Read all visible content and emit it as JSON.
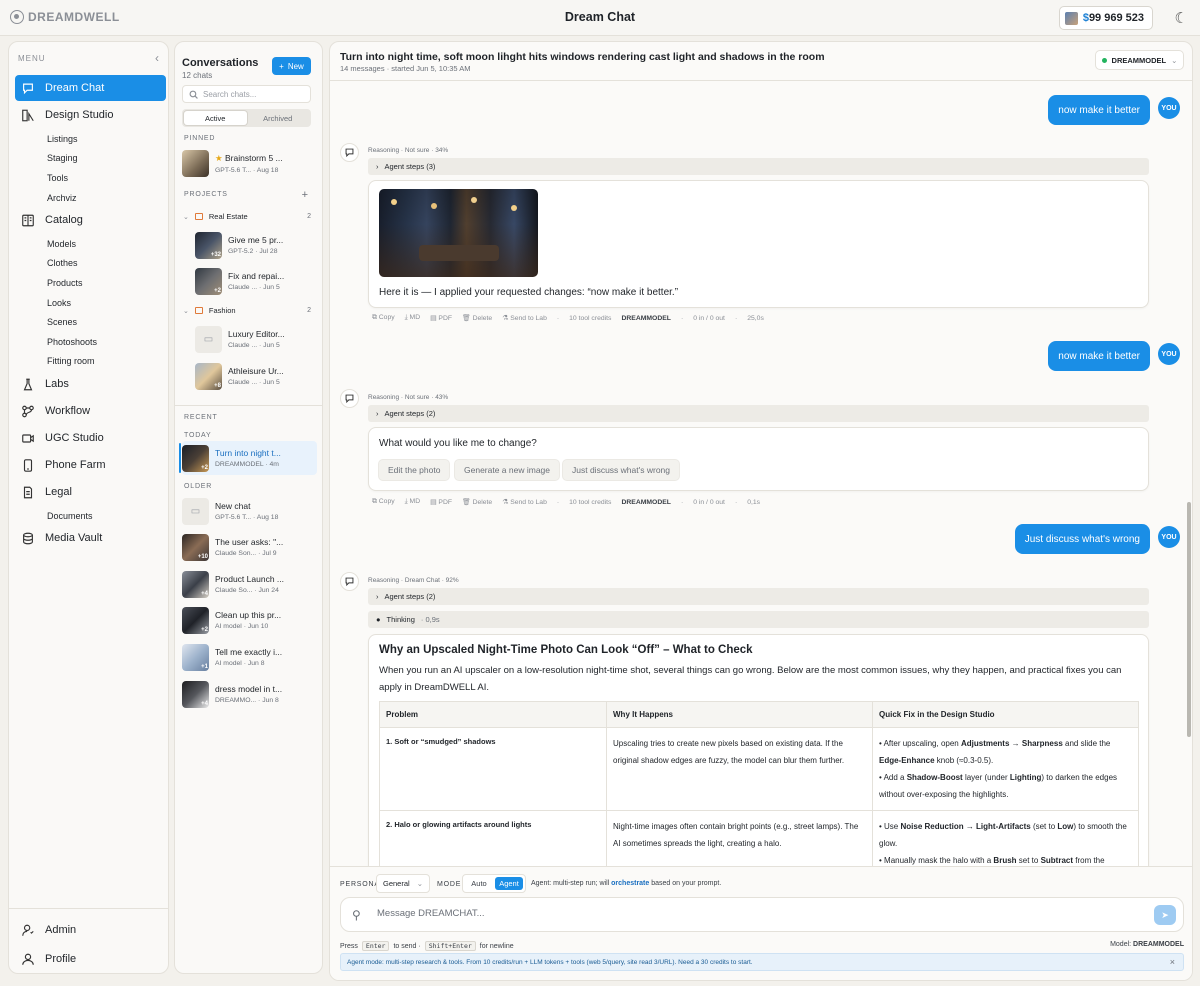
{
  "app": {
    "logo_text": "DREAMDWELL",
    "title": "Dream Chat",
    "credits": "99 969 523",
    "currency": "$"
  },
  "sidebar": {
    "menu_label": "MENU",
    "items": [
      {
        "label": "Dream Chat",
        "icon": "chat-icon",
        "active": true
      },
      {
        "label": "Design Studio",
        "icon": "design-icon"
      },
      {
        "label": "Catalog",
        "icon": "catalog-icon"
      },
      {
        "label": "Labs",
        "icon": "flask-icon"
      },
      {
        "label": "Workflow",
        "icon": "workflow-icon"
      },
      {
        "label": "UGC Studio",
        "icon": "ugc-icon"
      },
      {
        "label": "Phone Farm",
        "icon": "phone-icon"
      },
      {
        "label": "Legal",
        "icon": "document-icon"
      },
      {
        "label": "Media Vault",
        "icon": "database-icon"
      }
    ],
    "design_sub": [
      "Listings",
      "Staging",
      "Tools",
      "Archviz"
    ],
    "catalog_sub": [
      "Models",
      "Clothes",
      "Products",
      "Looks",
      "Scenes",
      "Photoshoots",
      "Fitting room"
    ],
    "legal_sub": [
      "Documents"
    ],
    "bottom": [
      {
        "label": "Admin",
        "icon": "admin-icon"
      },
      {
        "label": "Profile",
        "icon": "profile-icon"
      }
    ]
  },
  "conversations": {
    "title": "Conversations",
    "count": "12 chats",
    "new_label": "New",
    "search_placeholder": "Search chats...",
    "tabs": [
      "Active",
      "Archived"
    ],
    "pinned_label": "PINNED",
    "pinned": [
      {
        "title": "Brainstorm 5 ...",
        "meta": "GPT-5.6 T...  ·  Aug 18"
      }
    ],
    "projects_label": "PROJECTS",
    "folders": [
      {
        "name": "Real Estate",
        "count": "2",
        "items": [
          {
            "title": "Give me 5 pr...",
            "meta": "GPT-5.2  ·  Jul 28",
            "badge": "+32"
          },
          {
            "title": "Fix and repai...",
            "meta": "Claude ...  ·  Jun 5",
            "badge": "+2"
          }
        ]
      },
      {
        "name": "Fashion",
        "count": "2",
        "items": [
          {
            "title": "Luxury Editor...",
            "meta": "Claude ...  ·  Jun 5",
            "badge": ""
          },
          {
            "title": "Athleisure Ur...",
            "meta": "Claude ...  ·  Jun 5",
            "badge": "+8"
          }
        ]
      }
    ],
    "recent_label": "RECENT",
    "today_label": "TODAY",
    "today": [
      {
        "title": "Turn into night t...",
        "meta": "DREAMMODEL  ·  4m",
        "badge": "+2"
      }
    ],
    "older_label": "OLDER",
    "older": [
      {
        "title": "New chat",
        "meta": "GPT-5.6 T...  ·  Aug 18",
        "badge": ""
      },
      {
        "title": "The user asks: \"...",
        "meta": "Claude Son...  ·  Jul 9",
        "badge": "+10"
      },
      {
        "title": "Product Launch ...",
        "meta": "Claude So...  ·  Jun 24",
        "badge": "+4"
      },
      {
        "title": "Clean up this pr...",
        "meta": "AI model  ·  Jun 10",
        "badge": "+2"
      },
      {
        "title": "Tell me exactly i...",
        "meta": "AI model  ·  Jun 8",
        "badge": "+1"
      },
      {
        "title": "dress model in t...",
        "meta": "DREAMMO...  ·  Jun 8",
        "badge": "+4"
      }
    ]
  },
  "chat": {
    "title": "Turn into night time, soft moon lihght hits windows rendering cast light and shadows in the room",
    "subtitle": "14 messages · started Jun 5, 10:35 AM",
    "model": "DREAMMODEL",
    "user_messages": [
      "now make it better",
      "now make it better",
      "Just discuss what's wrong"
    ],
    "you_label": "YOU",
    "bot1": {
      "meta": "Reasoning  ·  Not sure · 34%",
      "steps": "Agent steps (3)",
      "text": "Here it is — I applied your requested changes: “now make it better.”",
      "credits": "10 tool credits",
      "tokens": "0 in / 0 out",
      "time": "25,0s"
    },
    "bot2": {
      "meta": "Reasoning  ·  Not sure · 43%",
      "steps": "Agent steps (2)",
      "question": "What would you like me to change?",
      "chips": [
        "Edit the photo",
        "Generate a new image",
        "Just discuss what's wrong"
      ],
      "credits": "10 tool credits",
      "tokens": "0 in / 0 out",
      "time": "0,1s"
    },
    "bot3": {
      "meta": "Reasoning  ·  Dream Chat · 92%",
      "steps": "Agent steps (2)",
      "thinking": "Thinking",
      "thinking_time": "· 0,9s",
      "doc_title": "Why an Upscaled Night‑Time Photo Can Look “Off” – What to Check",
      "intro": "When you run an AI upscaler on a low‑resolution night‑time shot, several things can go wrong. Below are the most common issues, why they happen, and practical fixes you can apply in DreamDWELL AI.",
      "headers": [
        "Problem",
        "Why It Happens",
        "Quick Fix in the Design Studio"
      ],
      "rows": [
        {
          "problem": "1. Soft or “smudged” shadows",
          "why": "Upscaling tries to create new pixels based on existing data. If the original shadow edges are fuzzy, the model can blur them further.",
          "fix1_a": "• After upscaling, open ",
          "fix1_b": "Adjustments → Sharpness",
          "fix1_c": " and slide the ",
          "fix1_d": "Edge‑Enhance",
          "fix1_e": " knob (≈0.3‑0.5).",
          "fix2_a": "• Add a ",
          "fix2_b": "Shadow‑Boost",
          "fix2_c": " layer (under ",
          "fix2_d": "Lighting",
          "fix2_e": ") to darken the edges without over‑exposing the highlights."
        },
        {
          "problem": "2. Halo or glowing artifacts around lights",
          "why": "Night‑time images often contain bright points (e.g., street lamps). The AI sometimes spreads the light, creating a halo.",
          "fix1_a": "• Use ",
          "fix1_b": "Noise Reduction → Light‑Artifacts",
          "fix1_c": " (set to ",
          "fix1_d": "Low",
          "fix1_e": ") to smooth the glow.",
          "fix2_a": "• Manually mask the halo with a ",
          "fix2_b": "Brush",
          "fix2_c": " set to ",
          "fix2_d": "Subtract",
          "fix2_e": " from the"
        }
      ]
    },
    "actions": [
      "Copy",
      "MD",
      "PDF",
      "Delete",
      "Send to Lab"
    ]
  },
  "composer": {
    "persona_label": "PERSONA",
    "persona": "General",
    "mode_label": "MODE",
    "modes": [
      "Auto",
      "Agent"
    ],
    "mode_help_a": "Agent: multi-step run; will ",
    "mode_help_link": "orchestrate",
    "mode_help_b": " based on your prompt.",
    "placeholder": "Message DREAMCHAT...",
    "hint_press": "Press",
    "hint_enter": "Enter",
    "hint_send": "to send ·",
    "hint_shift": "Shift+Enter",
    "hint_newline": "for newline",
    "model_label": "Model:",
    "model": "DREAMMODEL",
    "banner": "Agent mode: multi-step research & tools. From 10 credits/run + LLM tokens + tools (web 5/query, site read 3/URL). Need a 30 credits to start."
  }
}
